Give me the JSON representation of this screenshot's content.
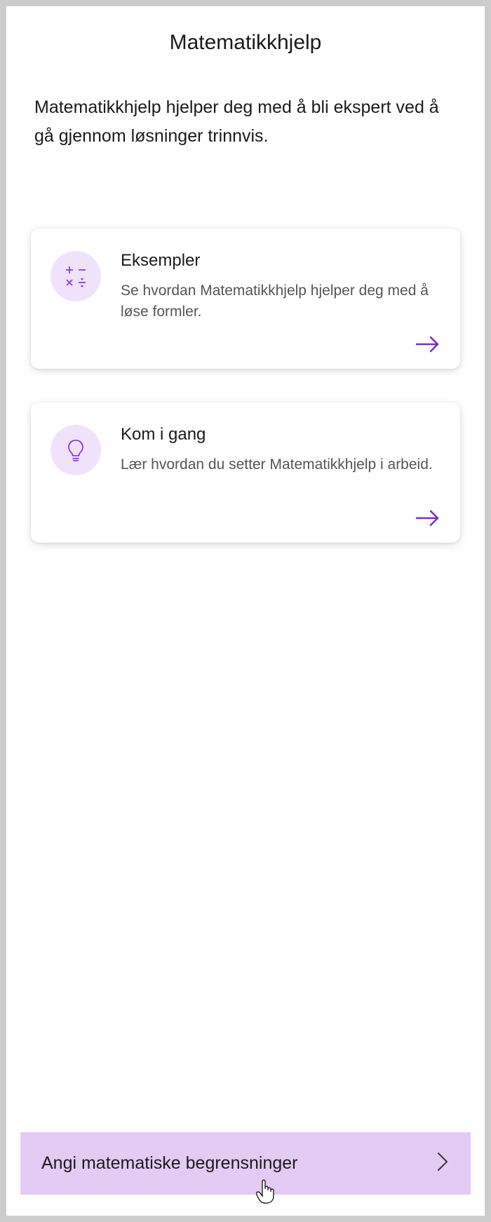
{
  "header": {
    "title": "Matematikkhjelp"
  },
  "description": {
    "text": "Matematikkhjelp hjelper deg med å bli ekspert ved å gå gjennom løsninger trinnvis."
  },
  "cards": [
    {
      "title": "Eksempler",
      "subtitle": "Se hvordan Matematikkhjelp hjelper deg med å løse formler.",
      "icon": "math-operators-icon"
    },
    {
      "title": "Kom i gang",
      "subtitle": "Lær hvordan du setter Matematikkhjelp i arbeid.",
      "icon": "lightbulb-icon"
    }
  ],
  "bottomBar": {
    "label": "Angi matematiske begrensninger"
  },
  "colors": {
    "accent": "#7b2fbf",
    "iconBg": "#f1e2fb",
    "bottomBarBg": "#e4cbf3"
  }
}
